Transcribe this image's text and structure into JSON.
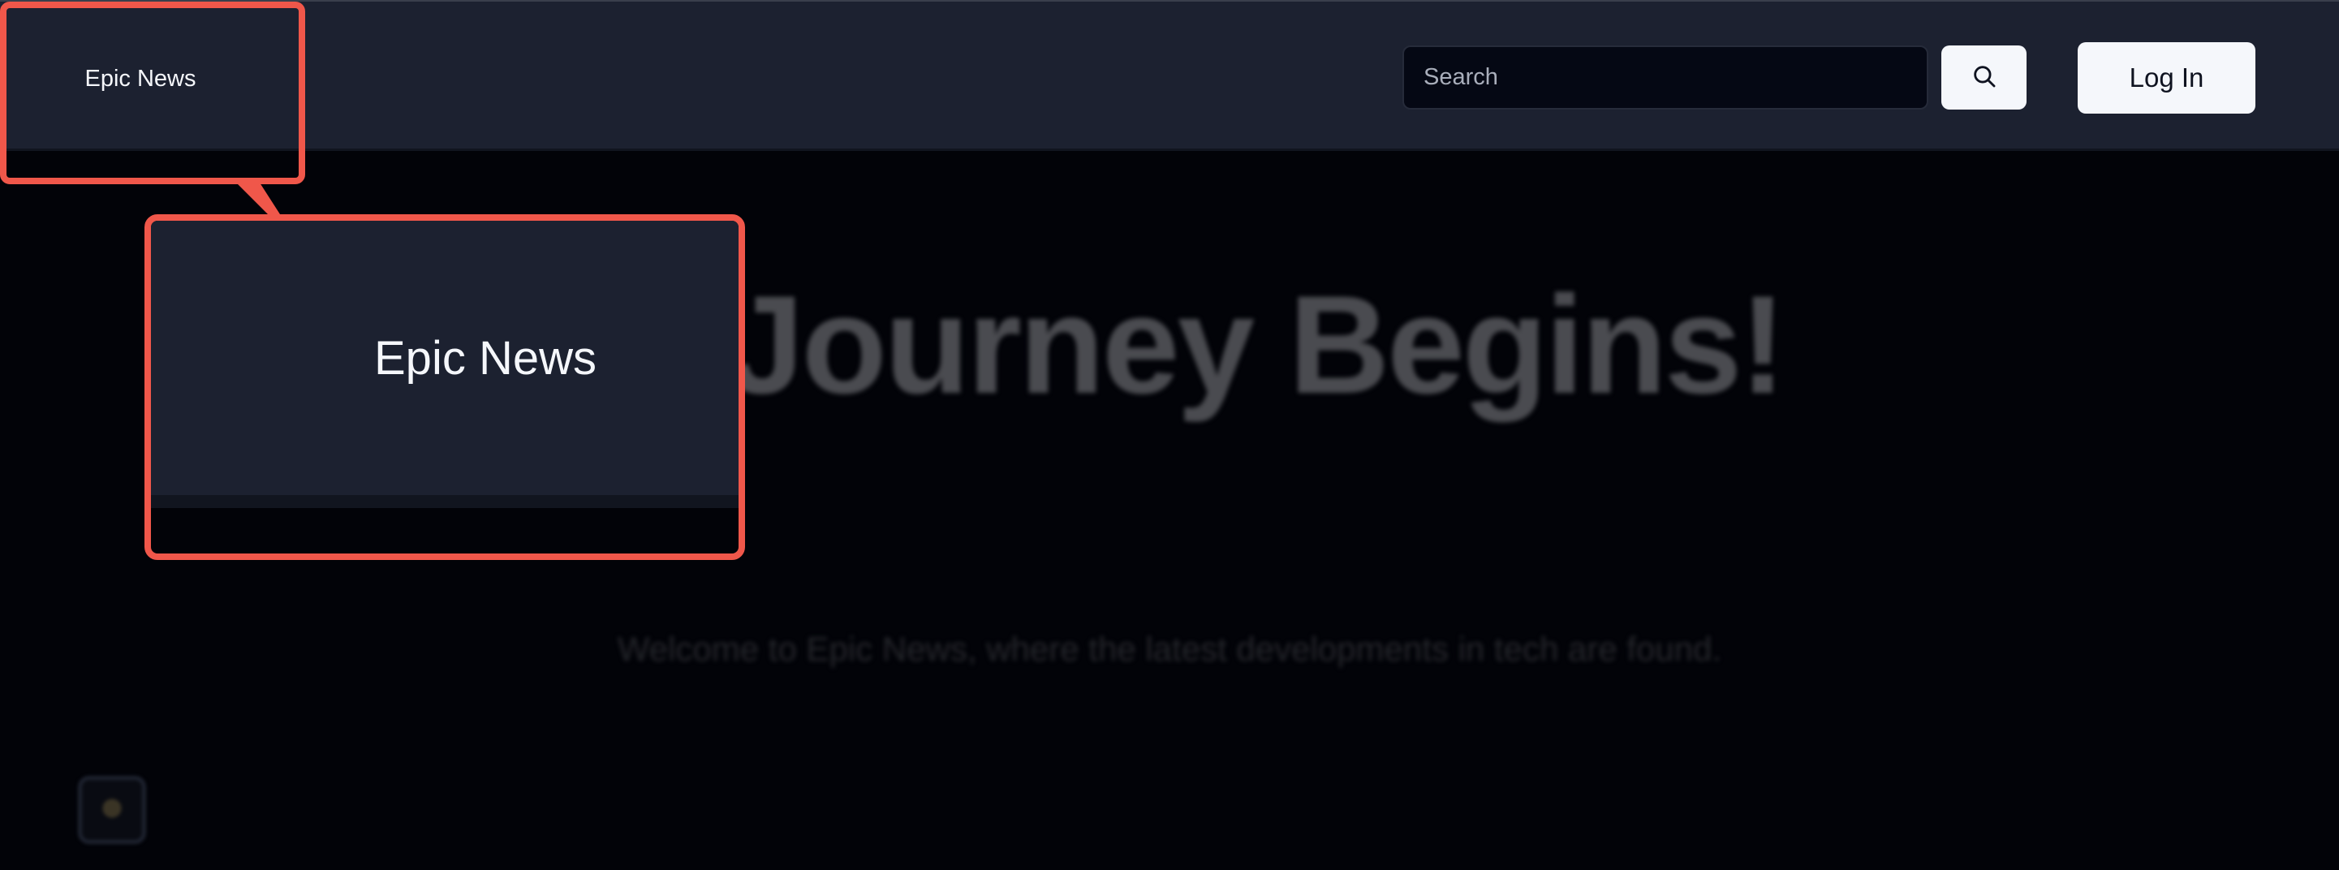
{
  "header": {
    "logo_text": "Epic News",
    "search": {
      "placeholder": "Search",
      "value": ""
    },
    "search_icon": "search-icon",
    "login_label": "Log In"
  },
  "main": {
    "title": "ur Journey Begins!",
    "subtitle": "Welcome to Epic News, where the latest developments in tech are found.",
    "theme_toggle_icon": "theme-toggle-icon"
  },
  "callout": {
    "zoom_text": "Epic News"
  },
  "colors": {
    "header_bg": "#1c2130",
    "page_bg": "#020308",
    "highlight": "#f0574a",
    "button_bg": "#f5f7fb"
  }
}
